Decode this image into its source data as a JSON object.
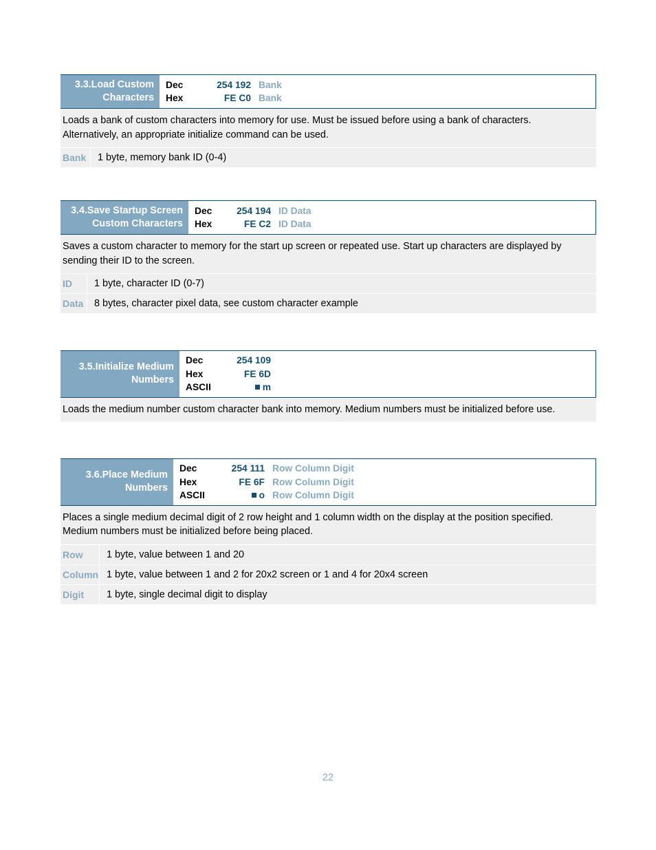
{
  "document": {
    "page_number": "22",
    "accent_header_bg": "#83a8c1",
    "accent_border": "#11486b",
    "code_value_color": "#13506f",
    "param_label_color": "#8aaabf",
    "row_bg": "#efefef"
  },
  "commands": [
    {
      "title_lines": [
        "3.3.Load Custom",
        "Characters"
      ],
      "code_rows": [
        {
          "label": "Dec",
          "value": "254 192",
          "params": "Bank",
          "ascii_square": false
        },
        {
          "label": "Hex",
          "value": "FE C0",
          "params": "Bank",
          "ascii_square": false
        }
      ],
      "description": "Loads a bank of custom characters into memory for use.  Must be issued before using a bank of characters.  Alternatively, an appropriate initialize command can be used.",
      "parameters": [
        {
          "name": "Bank",
          "description": "1 byte, memory bank ID (0-4)"
        }
      ]
    },
    {
      "title_lines": [
        "3.4.Save Startup Screen",
        "Custom Characters"
      ],
      "code_rows": [
        {
          "label": "Dec",
          "value": "254 194",
          "params": "ID Data",
          "ascii_square": false
        },
        {
          "label": "Hex",
          "value": "FE C2",
          "params": "ID Data",
          "ascii_square": false
        }
      ],
      "description": "Saves a custom character to memory for the start up screen or repeated use.  Start up characters are displayed by sending their ID to the screen.",
      "parameters": [
        {
          "name": "ID",
          "description": "1 byte, character ID (0-7)"
        },
        {
          "name": "Data",
          "description": "8 bytes, character pixel data, see custom character example"
        }
      ]
    },
    {
      "title_lines": [
        "3.5.Initialize Medium",
        "Numbers"
      ],
      "code_rows": [
        {
          "label": "Dec",
          "value": "254 109",
          "params": "",
          "ascii_square": false
        },
        {
          "label": "Hex",
          "value": "FE 6D",
          "params": "",
          "ascii_square": false
        },
        {
          "label": "ASCII",
          "value": "m",
          "params": "",
          "ascii_square": true
        }
      ],
      "description": "Loads the medium number custom character bank into memory.  Medium numbers must be initialized before use.",
      "parameters": []
    },
    {
      "title_lines": [
        "3.6.Place Medium",
        "Numbers"
      ],
      "code_rows": [
        {
          "label": "Dec",
          "value": "254 111",
          "params": "Row Column Digit",
          "ascii_square": false
        },
        {
          "label": "Hex",
          "value": "FE 6F",
          "params": "Row Column Digit",
          "ascii_square": false
        },
        {
          "label": "ASCII",
          "value": "o",
          "params": "Row Column Digit",
          "ascii_square": true
        }
      ],
      "description": "Places a single medium decimal digit of 2 row height and 1 column width on the display at the position specified.  Medium numbers must be initialized before being placed.",
      "parameters": [
        {
          "name": "Row",
          "description": "1 byte, value between 1 and 20"
        },
        {
          "name": "Column",
          "description": "1 byte, value between 1 and 2 for 20x2 screen or 1 and 4 for 20x4 screen"
        },
        {
          "name": "Digit",
          "description": "1 byte, single decimal digit to display"
        }
      ]
    }
  ]
}
